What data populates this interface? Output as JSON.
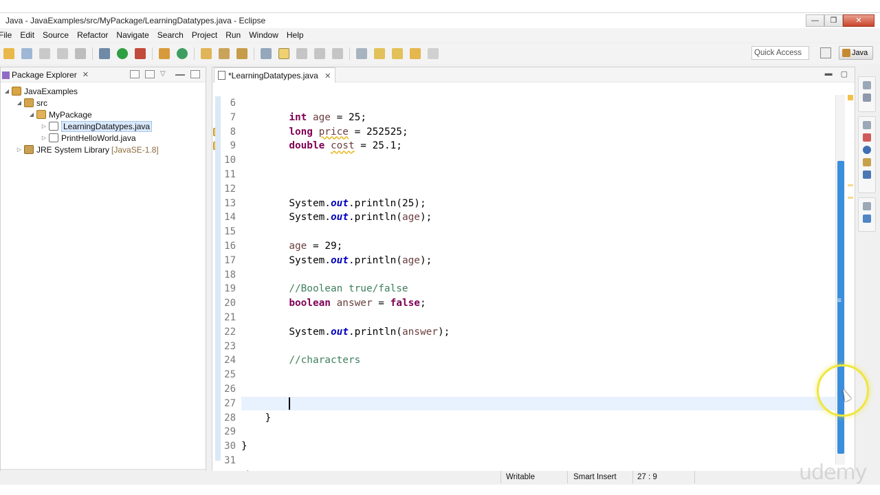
{
  "window": {
    "title": "Java - JavaExamples/src/MyPackage/LearningDatatypes.java - Eclipse",
    "controls": {
      "minimize": "—",
      "maximize": "❐",
      "close": "✕"
    }
  },
  "menu": [
    "File",
    "Edit",
    "Source",
    "Refactor",
    "Navigate",
    "Search",
    "Project",
    "Run",
    "Window",
    "Help"
  ],
  "toolbar": {
    "quick_access": "Quick Access",
    "perspective": "Java"
  },
  "package_explorer": {
    "title": "Package Explorer",
    "tree": [
      {
        "label": "JavaExamples",
        "level": 0,
        "twisty": "◢",
        "icon": "project-icon"
      },
      {
        "label": "src",
        "level": 1,
        "twisty": "◢",
        "icon": "source-folder-icon"
      },
      {
        "label": "MyPackage",
        "level": 2,
        "twisty": "◢",
        "icon": "package-icon"
      },
      {
        "label": "LearningDatatypes.java",
        "level": 3,
        "twisty": "▷",
        "icon": "java-file-icon",
        "selected": true
      },
      {
        "label": "PrintHelloWorld.java",
        "level": 3,
        "twisty": "▷",
        "icon": "java-file-icon"
      },
      {
        "label": "JRE System Library",
        "level": 1,
        "twisty": "▷",
        "icon": "library-icon",
        "suffix": "[JavaSE-1.8]"
      }
    ]
  },
  "editor": {
    "tab_label": "*LearningDatatypes.java",
    "current_line": 27,
    "lines": [
      {
        "n": "6",
        "code": ""
      },
      {
        "n": "7",
        "code": "        int age = 25;"
      },
      {
        "n": "8",
        "code": "        long price = 252525;"
      },
      {
        "n": "9",
        "code": "        double cost = 25.1;"
      },
      {
        "n": "10",
        "code": ""
      },
      {
        "n": "11",
        "code": ""
      },
      {
        "n": "12",
        "code": ""
      },
      {
        "n": "13",
        "code": "        System.out.println(25);"
      },
      {
        "n": "14",
        "code": "        System.out.println(age);"
      },
      {
        "n": "15",
        "code": ""
      },
      {
        "n": "16",
        "code": "        age = 29;"
      },
      {
        "n": "17",
        "code": "        System.out.println(age);"
      },
      {
        "n": "18",
        "code": ""
      },
      {
        "n": "19",
        "code": "        //Boolean true/false"
      },
      {
        "n": "20",
        "code": "        boolean answer = false;"
      },
      {
        "n": "21",
        "code": ""
      },
      {
        "n": "22",
        "code": "        System.out.println(answer);"
      },
      {
        "n": "23",
        "code": ""
      },
      {
        "n": "24",
        "code": "        //characters"
      },
      {
        "n": "25",
        "code": ""
      },
      {
        "n": "26",
        "code": ""
      },
      {
        "n": "27",
        "code": ""
      },
      {
        "n": "28",
        "code": "    }"
      },
      {
        "n": "29",
        "code": ""
      },
      {
        "n": "30",
        "code": "}"
      },
      {
        "n": "31",
        "code": ""
      }
    ]
  },
  "status": {
    "writable": "Writable",
    "insert_mode": "Smart Insert",
    "position": "27 : 9"
  },
  "watermark": "udemy",
  "colors": {
    "keyword": "#7f0055",
    "static_field": "#0000c0",
    "comment": "#3f7f5f",
    "local_var": "#6a3e3e",
    "scroll_thumb": "#3b8edc",
    "cursor_ring": "#f0e63d"
  }
}
